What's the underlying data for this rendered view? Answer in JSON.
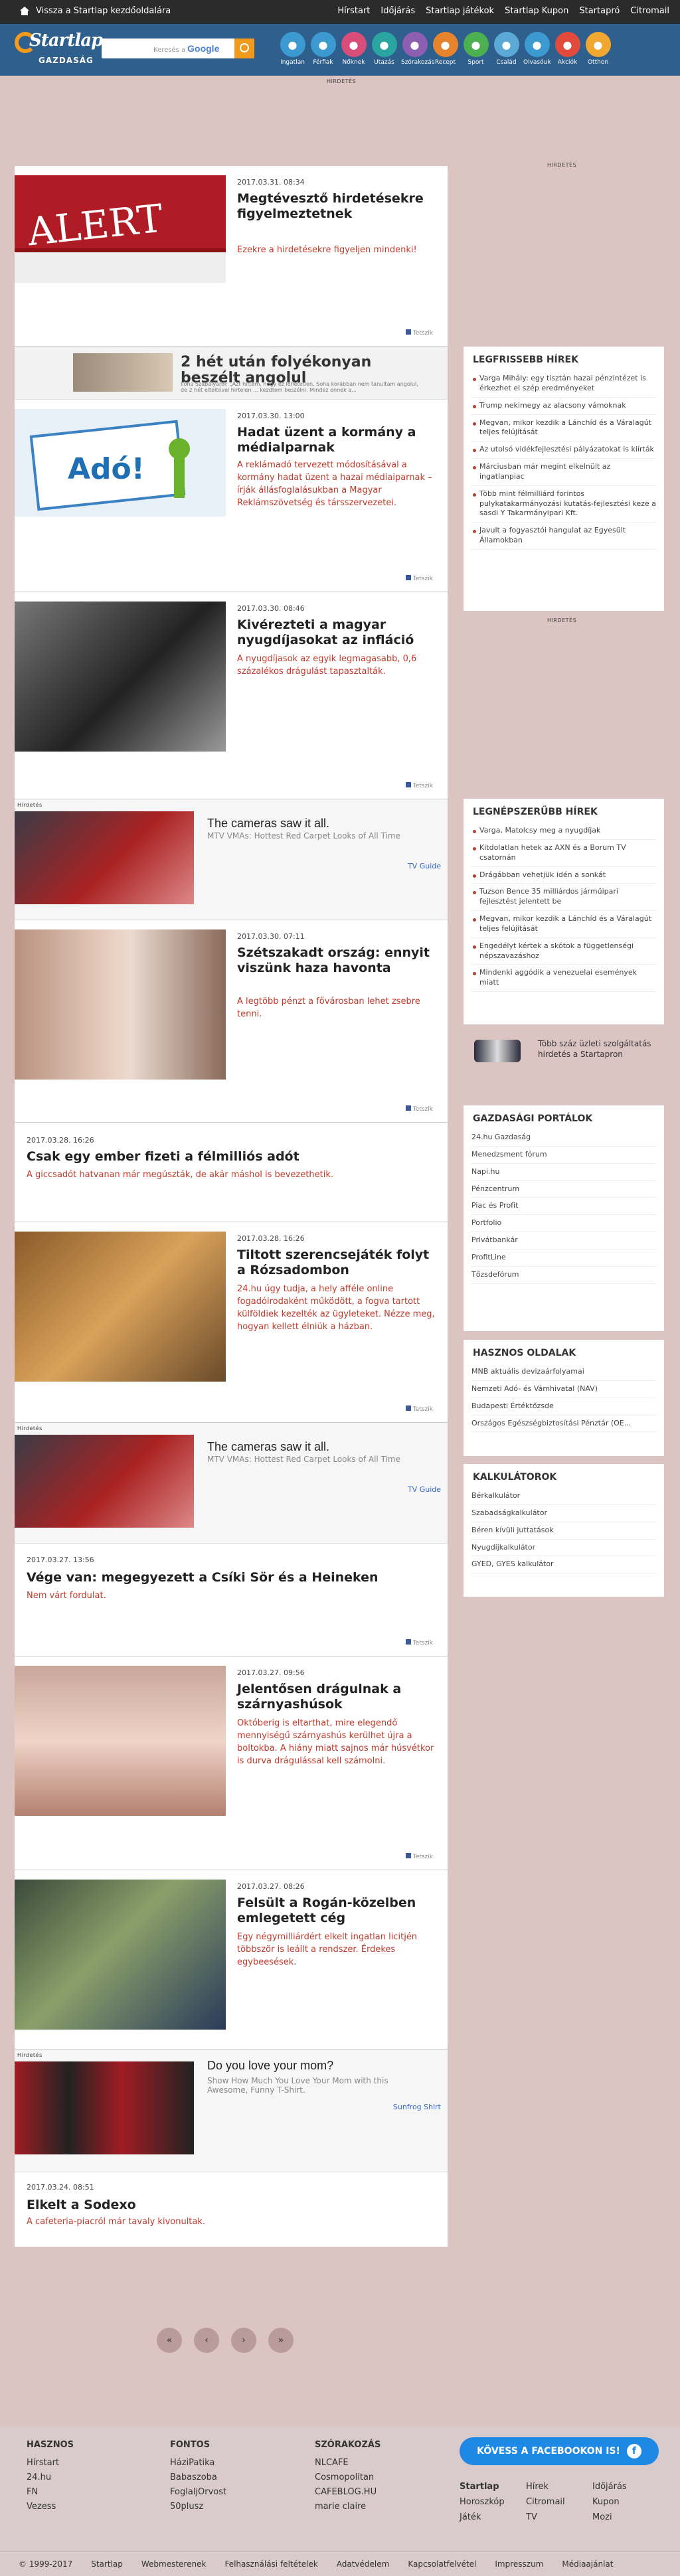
{
  "topbar": {
    "back": "Vissza a Startlap kezdőoldalára",
    "links": [
      "Hírstart",
      "Időjárás",
      "Startlap játékok",
      "Startlap Kupon",
      "Startapró",
      "Citromail"
    ]
  },
  "header": {
    "logo": "Startlap",
    "section": "GAZDASÁG",
    "search_placeholder": "Keresés a",
    "search_brand": "Google",
    "cats": [
      {
        "label": "Ingatlan",
        "color": "#3d9ad1"
      },
      {
        "label": "Férfiak",
        "color": "#3d9ad1"
      },
      {
        "label": "Nőknek",
        "color": "#d94d7a"
      },
      {
        "label": "Utazás",
        "color": "#2aa5a0"
      },
      {
        "label": "Szórakozás",
        "color": "#8e5eb0"
      },
      {
        "label": "Recept",
        "color": "#e6842d"
      },
      {
        "label": "Sport",
        "color": "#4caf50"
      },
      {
        "label": "Család",
        "color": "#5aa9d6"
      },
      {
        "label": "Olvasóuk",
        "color": "#3d9ad1"
      },
      {
        "label": "Akciók",
        "color": "#e24b3b"
      },
      {
        "label": "Otthon",
        "color": "#f0a830"
      }
    ]
  },
  "ads": {
    "label": "HIRDETÉS",
    "label_small": "Hirdetés"
  },
  "articles": [
    {
      "date": "2017.03.31. 08:34",
      "title": "Megtévesztő hirdetésekre figyelmeztetnek",
      "lead": "Ezekre a hirdetésekre figyeljen mindenki!",
      "img_text": "ALERT"
    },
    {
      "date": "2017.03.30. 13:00",
      "title": "Hadat üzent a kormány a médialparnak",
      "lead": "A reklámadó tervezett módosításával a kormány hadat üzent a hazai médiaiparnak – írják állásfoglalásukban a Magyar Reklámszövetség és társszervezetei.",
      "img_text": "Adó!"
    },
    {
      "date": "2017.03.30. 08:46",
      "title": "Kivérezteti a magyar nyugdíjasokat az infláció",
      "lead": "A nyugdíjasok az egyik legmagasabb, 0,6 százalékos drágulást tapasztalták."
    },
    {
      "date": "2017.03.30. 07:11",
      "title": "Szétszakadt ország: ennyit viszünk haza havonta",
      "lead": "A legtöbb pénzt a fővárosban lehet zsebre tenni."
    },
    {
      "date": "2017.03.28. 16:26",
      "title": "Csak egy ember fizeti a félmilliós adót",
      "lead": "A giccsadót hatvanan már megúszták, de akár máshol is bevezethetik."
    },
    {
      "date": "2017.03.28. 16:26",
      "title": "Tiltott szerencsejáték folyt a Rózsadombon",
      "lead": "24.hu úgy tudja, a hely afféle online fogadóirodaként működött, a fogva tartott külföldiek kezelték az ügyleteket. Nézze meg, hogyan kellett élniük a házban."
    },
    {
      "date": "2017.03.27. 13:56",
      "title": "Vége van: megegyezett a Csíki Sör és a Heineken",
      "lead": "Nem várt fordulat."
    },
    {
      "date": "2017.03.27. 09:56",
      "title": "Jelentősen drágulnak a szárnyashúsok",
      "lead": "Októberig is eltarthat, mire elegendő mennyiségű szárnyashús kerülhet újra a boltokba. A hiány miatt sajnos már húsvétkor is durva drágulással kell számolni."
    },
    {
      "date": "2017.03.27. 08:26",
      "title": "Felsült a Rogán-közelben emlegetett cég",
      "lead": "Egy négymilliárdért elkelt ingatlan licitjén többször is leállt a rendszer. Érdekes egybeesések."
    },
    {
      "date": "2017.03.24. 08:51",
      "title": "Elkelt a Sodexo",
      "lead": "A cafeteria-piacról már tavaly kivonultak."
    }
  ],
  "share": "Tetszik",
  "inline_ad": {
    "title": "2 hét után folyékonyan beszélt angolul",
    "text": "Ilona Szabályáról: „Azt hittem, hogy ez lehetetlen. Soha korábban nem tanultam angolul, de 2 hét elteltével hirtelen ... kezdtem beszélni. Mindez ennek a..."
  },
  "promos": [
    {
      "title": "The cameras saw it all.",
      "desc": "MTV VMAs: Hottest Red Carpet Looks of All Time",
      "link": "TV Guide"
    },
    {
      "title": "The cameras saw it all.",
      "desc": "MTV VMAs: Hottest Red Carpet Looks of All Time",
      "link": "TV Guide"
    },
    {
      "title": "Do you love your mom?",
      "desc": "Show How Much You Love Your Mom with this Awesome, Funny T-Shirt.",
      "link": "Sunfrog Shirt"
    }
  ],
  "sidebar": {
    "latest_title": "LEGFRISSEBB HÍREK",
    "latest": [
      "Varga Mihály: egy tisztán hazai pénzintézet is érkezhet el szép eredményeket",
      "Trump nekimegy az alacsony vámoknak",
      "Megvan, mikor kezdik a Lánchíd és a Váralagút teljes felújítását",
      "Az utolsó vidékfejlesztési pályázatokat is kiírták",
      "Márciusban már megint elkelnült az ingatlanpiac",
      "Több mint félmilliárd forintos pulykatakarmányozási kutatás-fejlesztési keze a sasdi Y Takarmányipari Kft.",
      "Javult a fogyasztói hangulat az Egyesült Államokban"
    ],
    "popular_title": "LEGNÉPSZERŰBB HÍREK",
    "popular": [
      "Varga, Matolcsy meg a nyugdíjak",
      "Kitdolatlan hetek az AXN és a Borum TV csatornán",
      "Drágábban vehetjük idén a sonkát",
      "Tuzson Bence 35 milliárdos járműipari fejlesztést jelentett be",
      "Megvan, mikor kezdik a Lánchíd és a Váralagút teljes felújítását",
      "Engedélyt kértek a skótok a függetlenségi népszavazáshoz",
      "Mindenki aggódik a venezuelai események miatt"
    ],
    "promo_text": "Több száz üzleti szolgáltatás hirdetés a Startapron",
    "portals_title": "GAZDASÁGI PORTÁLOK",
    "portals": [
      "24.hu Gazdaság",
      "Menedzsment fórum",
      "Napi.hu",
      "Pénzcentrum",
      "Piac és Profit",
      "Portfolio",
      "Privátbankár",
      "ProfitLine",
      "Tőzsdefórum"
    ],
    "useful_title": "HASZNOS OLDALAK",
    "useful": [
      "MNB aktuális devizaárfolyamai",
      "Nemzeti Adó- és Vámhivatal (NAV)",
      "Budapesti Értéktőzsde",
      "Országos Egészségbiztosítási Pénztár (OE..."
    ],
    "calc_title": "KALKULÁTOROK",
    "calc": [
      "Bérkalkulátor",
      "Szabadságkalkulátor",
      "Béren kívüli juttatások",
      "Nyugdíjkalkulátor",
      "GYED, GYES kalkulátor"
    ]
  },
  "pager": [
    "«",
    "‹",
    "›",
    "»"
  ],
  "footer": {
    "cols": [
      {
        "title": "HASZNOS",
        "items": [
          "Hírstart",
          "24.hu",
          "FN",
          "Vezess"
        ]
      },
      {
        "title": "FONTOS",
        "items": [
          "HáziPatika",
          "Babaszoba",
          "FoglaljOrvost",
          "50plusz"
        ]
      },
      {
        "title": "SZÓRAKOZÁS",
        "items": [
          "NLCAFE",
          "Cosmopolitan",
          "CAFEBLOG.HU",
          "marie claire"
        ]
      }
    ],
    "fb": "KÖVESS A FACEBOOKON IS!",
    "grid": [
      "Startlap",
      "Hírek",
      "Időjárás",
      "Horoszkóp",
      "Citromail",
      "Kupon",
      "Játék",
      "TV",
      "Mozi"
    ],
    "bottom": [
      "© 1999-2017",
      "Startlap",
      "Webmesterenek",
      "Felhasználási feltételek",
      "Adatvédelem",
      "Kapcsolatfelvétel",
      "Impresszum",
      "Médiaajánlat"
    ]
  }
}
